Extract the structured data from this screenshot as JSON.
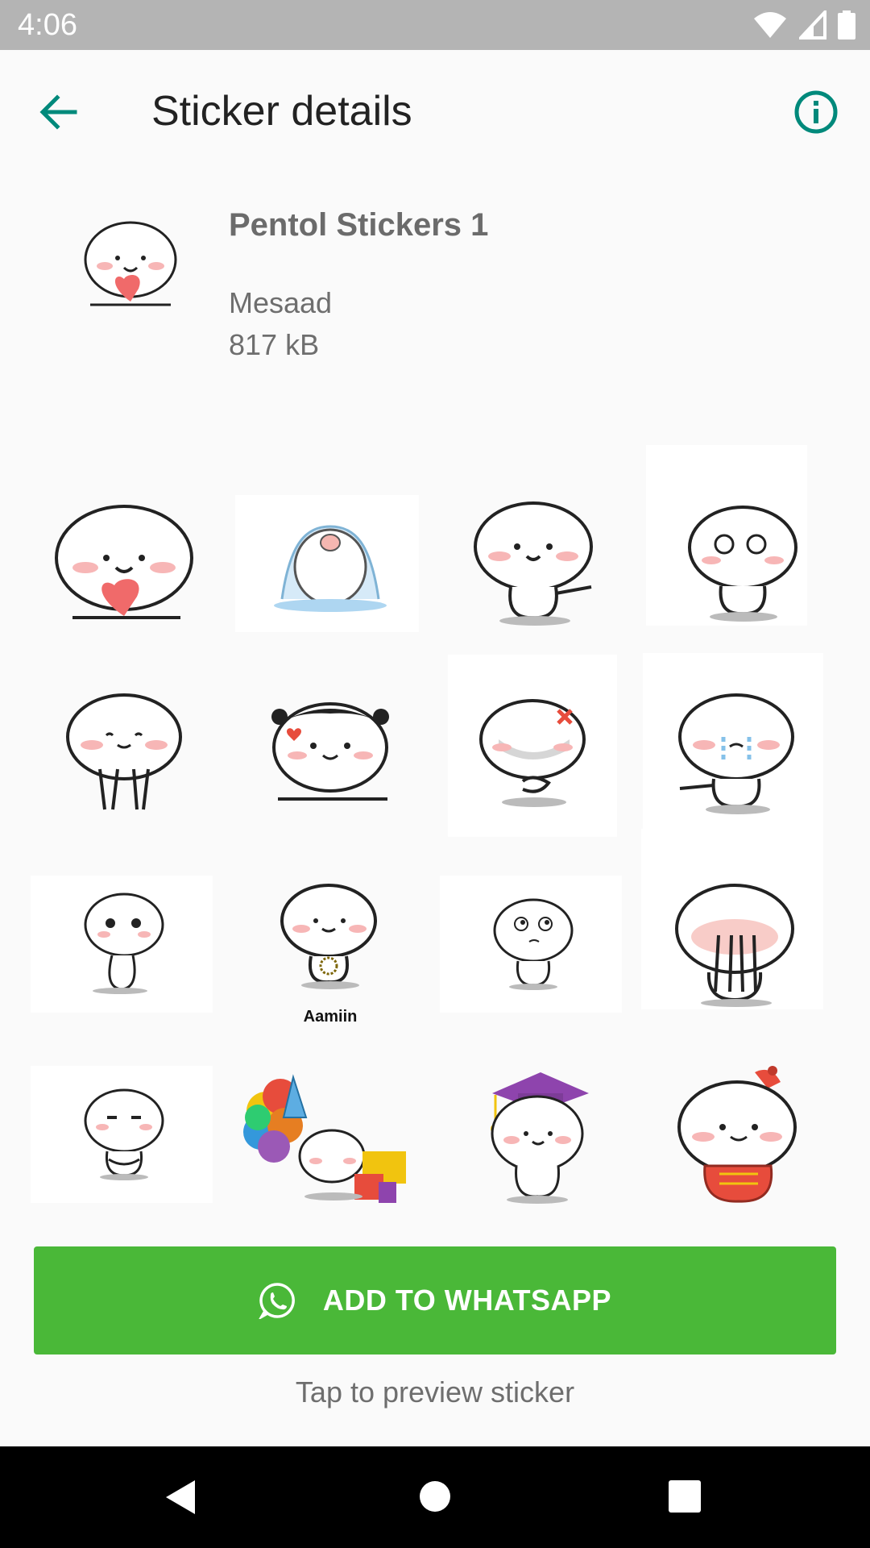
{
  "status_bar": {
    "time": "4:06",
    "icons": [
      "wifi-icon",
      "signal-icon",
      "battery-icon"
    ]
  },
  "app_bar": {
    "title": "Sticker details",
    "back_icon": "arrow-left-icon",
    "info_icon": "info-circle-icon"
  },
  "pack": {
    "name": "Pentol Stickers 1",
    "publisher": "Mesaad",
    "size": "817 kB"
  },
  "stickers": [
    {
      "id": 1,
      "caption": ""
    },
    {
      "id": 2,
      "caption": ""
    },
    {
      "id": 3,
      "caption": ""
    },
    {
      "id": 4,
      "caption": ""
    },
    {
      "id": 5,
      "caption": ""
    },
    {
      "id": 6,
      "caption": ""
    },
    {
      "id": 7,
      "caption": ""
    },
    {
      "id": 8,
      "caption": ""
    },
    {
      "id": 9,
      "caption": ""
    },
    {
      "id": 10,
      "caption": "Aamiin"
    },
    {
      "id": 11,
      "caption": ""
    },
    {
      "id": 12,
      "caption": ""
    },
    {
      "id": 13,
      "caption": ""
    },
    {
      "id": 14,
      "caption": ""
    },
    {
      "id": 15,
      "caption": ""
    },
    {
      "id": 16,
      "caption": ""
    }
  ],
  "add_button": {
    "label": "ADD TO WHATSAPP",
    "icon": "whatsapp-icon",
    "color": "#4ab838"
  },
  "hint": "Tap to preview sticker",
  "colors": {
    "accent": "#00897b",
    "status_bar": "#b4b4b4"
  },
  "nav_bar": {
    "icons": [
      "nav-back-icon",
      "nav-home-icon",
      "nav-recents-icon"
    ]
  }
}
